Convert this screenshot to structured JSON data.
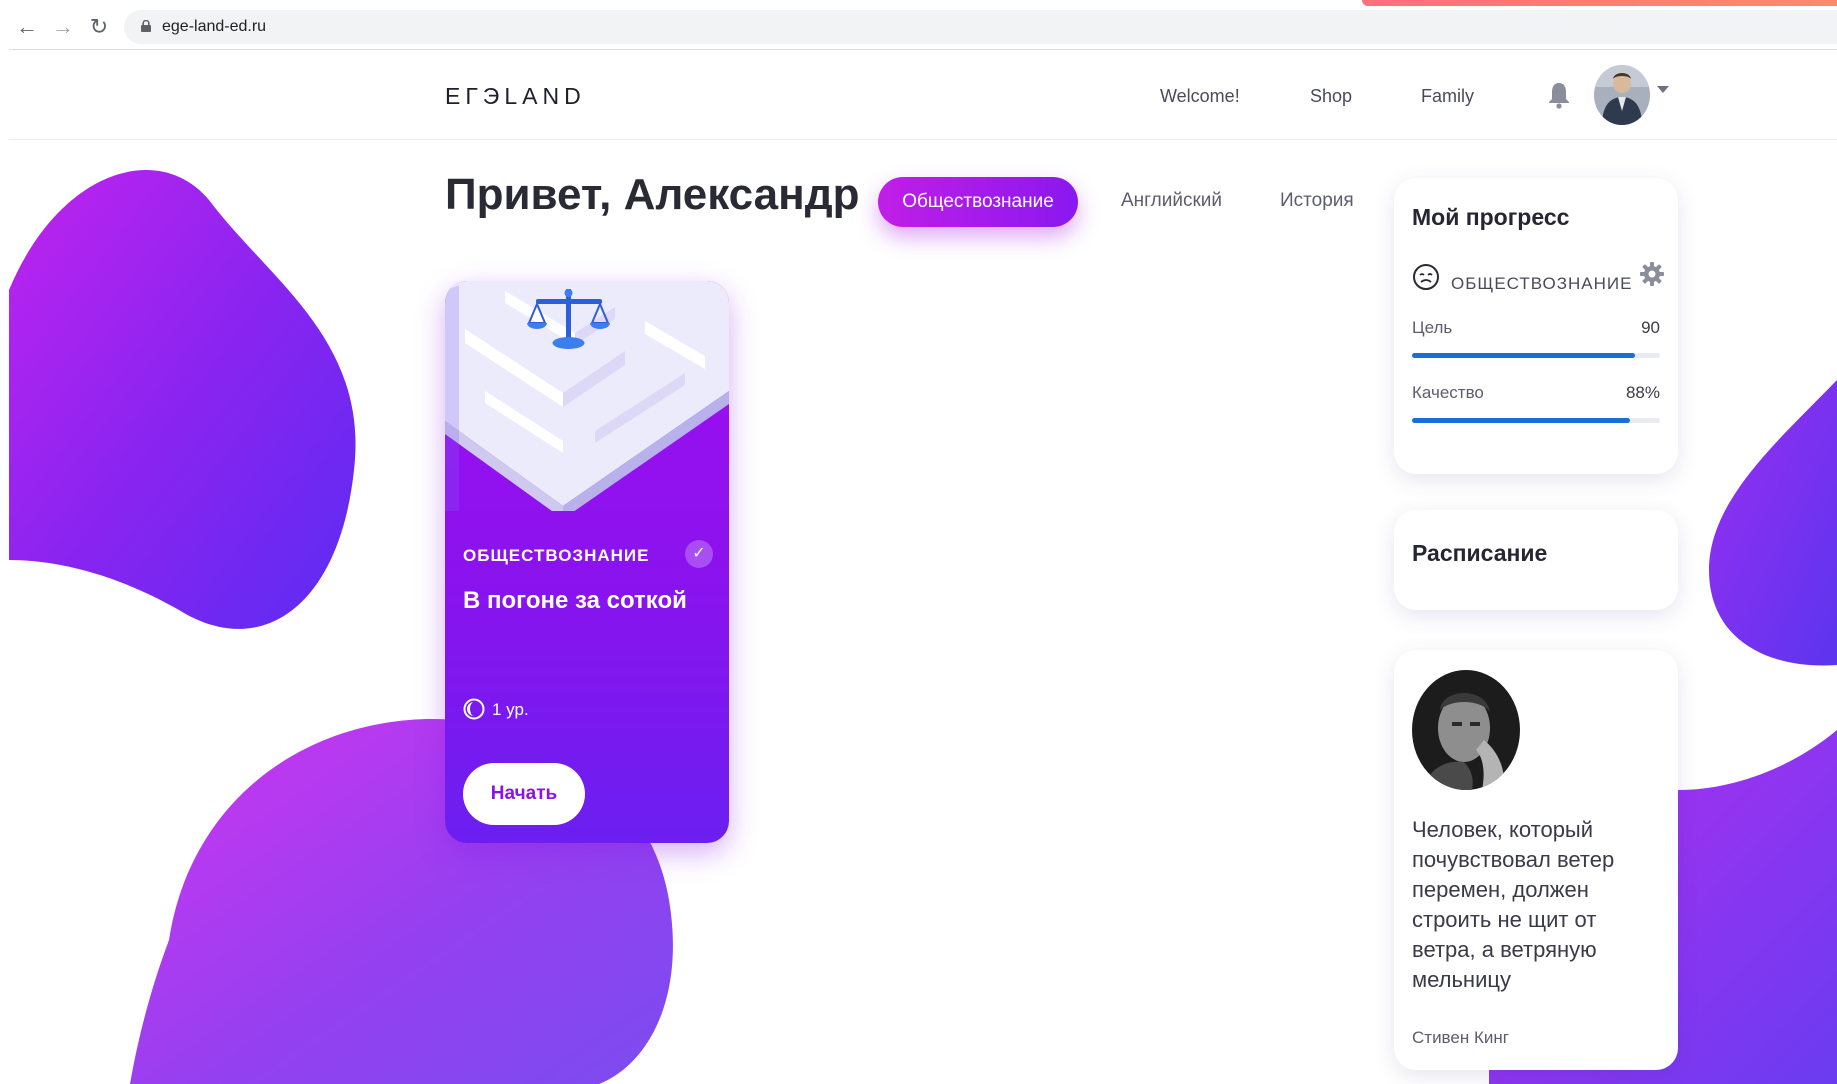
{
  "browser": {
    "url": "ege-land-ed.ru"
  },
  "header": {
    "logo": "ЕГЭLAND",
    "nav": [
      "Welcome!",
      "Shop",
      "Family"
    ]
  },
  "greeting": "Привет, Александр",
  "subject_tabs": [
    {
      "label": "Обществознание",
      "active": true
    },
    {
      "label": "Английский",
      "active": false
    },
    {
      "label": "История",
      "active": false
    }
  ],
  "course_card": {
    "subject": "ОБЩЕСТВОЗНАНИЕ",
    "title": "В погоне за соткой",
    "level": "1 ур.",
    "start_label": "Начать",
    "completed": true
  },
  "progress": {
    "title": "Мой прогресс",
    "subject": "ОБЩЕСТВОЗНАНИЕ",
    "metrics": [
      {
        "label": "Цель",
        "value": "90",
        "fill": 0.9
      },
      {
        "label": "Качество",
        "value": "88%",
        "fill": 0.88
      }
    ]
  },
  "schedule": {
    "title": "Расписание"
  },
  "quote": {
    "text": "Человек, который почувствовал ветер перемен, должен строить не щит от ветра, а ветряную мельницу",
    "author": "Стивен Кинг"
  },
  "colors": {
    "accent": "#8a13e8",
    "accent_pink": "#c11ee6",
    "progress_bar": "#1a6ed8"
  }
}
